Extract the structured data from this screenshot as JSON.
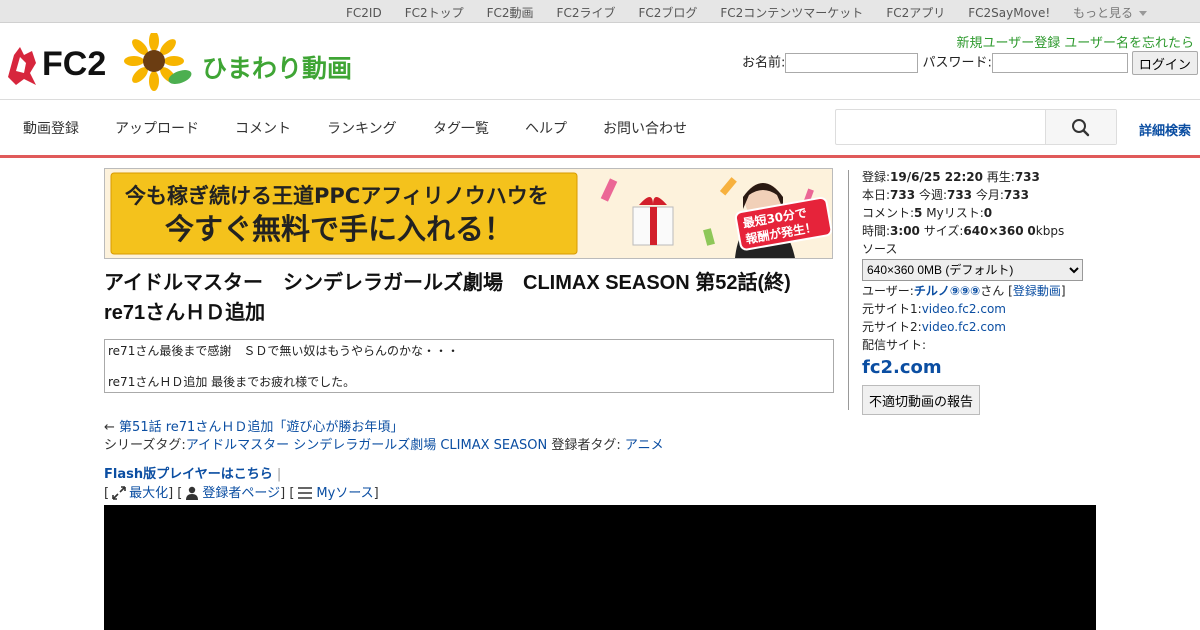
{
  "topbar": {
    "links": [
      "FC2ID",
      "FC2トップ",
      "FC2動画",
      "FC2ライブ",
      "FC2ブログ",
      "FC2コンテンツマーケット",
      "FC2アプリ",
      "FC2SayMove!"
    ],
    "more": "もっと見る"
  },
  "header": {
    "logo_text": "FC2",
    "logo_sub": "ひまわり動画",
    "register_link": "新規ユーザー登録",
    "forgot_link": "ユーザー名を忘れたら",
    "name_label": "お名前:",
    "password_label": "パスワード:",
    "login_button": "ログイン"
  },
  "nav": {
    "items": [
      "動画登録",
      "アップロード",
      "コメント",
      "ランキング",
      "タグ一覧",
      "ヘルプ",
      "お問い合わせ"
    ],
    "search_placeholder": "",
    "advanced_search": "詳細検索"
  },
  "banner": {
    "line1": "今も稼ぎ続ける王道PPCアフィリノウハウを",
    "line2": "今すぐ無料で手に入れる！",
    "badge": "最短30分で報酬が発生！"
  },
  "video": {
    "title": "アイドルマスター　シンデレラガールズ劇場　CLIMAX SEASON 第52話(終) re71さんＨＤ追加",
    "description_1": "re71さん最後まで感謝　ＳＤで無い奴はもうやらんのかな・・・",
    "description_2": "re71さんＨＤ追加 最後までお疲れ様でした。",
    "prev_arrow": "←",
    "prev_link": "第51話 re71さんＨＤ追加「遊び心が勝お年頃」",
    "series_tag_label": "シリーズタグ:",
    "series_tag": "アイドルマスター シンデレラガールズ劇場 CLIMAX SEASON",
    "user_tag_label": "登録者タグ:",
    "user_tag": "アニメ",
    "flash_link": "Flash版プレイヤーはこちら",
    "maximize": "最大化",
    "uploader_page": "登録者ページ",
    "my_source": "Myソース"
  },
  "side": {
    "registered_label": "登録:",
    "registered": "19/6/25 22:20",
    "plays_label": "再生:",
    "plays": "733",
    "today_label": "本日:",
    "today": "733",
    "week_label": "今週:",
    "week": "733",
    "month_label": "今月:",
    "month": "733",
    "comments_label": "コメント:",
    "comments": "5",
    "mylist_label": "Myリスト:",
    "mylist": "0",
    "time_label": "時間:",
    "time": "3:00",
    "size_label": "サイズ:",
    "size": "640×360",
    "bitrate": "0",
    "bitrate_unit": "kbps",
    "source_label": "ソース",
    "source_option": "640×360 0MB (デフォルト)",
    "user_label": "ユーザー:",
    "user_name": "チルノ⑨⑨⑨",
    "user_suffix": "さん",
    "user_videos": "登録動画",
    "origin1_label": "元サイト1:",
    "origin1": "video.fc2.com",
    "origin2_label": "元サイト2:",
    "origin2": "video.fc2.com",
    "dist_label": "配信サイト:",
    "dist_site": "fc2.com",
    "report_button": "不適切動画の報告"
  },
  "colors": {
    "nav_underline": "#e05a5a",
    "link": "#0b4ea2",
    "register_link": "#2e9a2e",
    "banner_yellow": "#f4c21c"
  }
}
